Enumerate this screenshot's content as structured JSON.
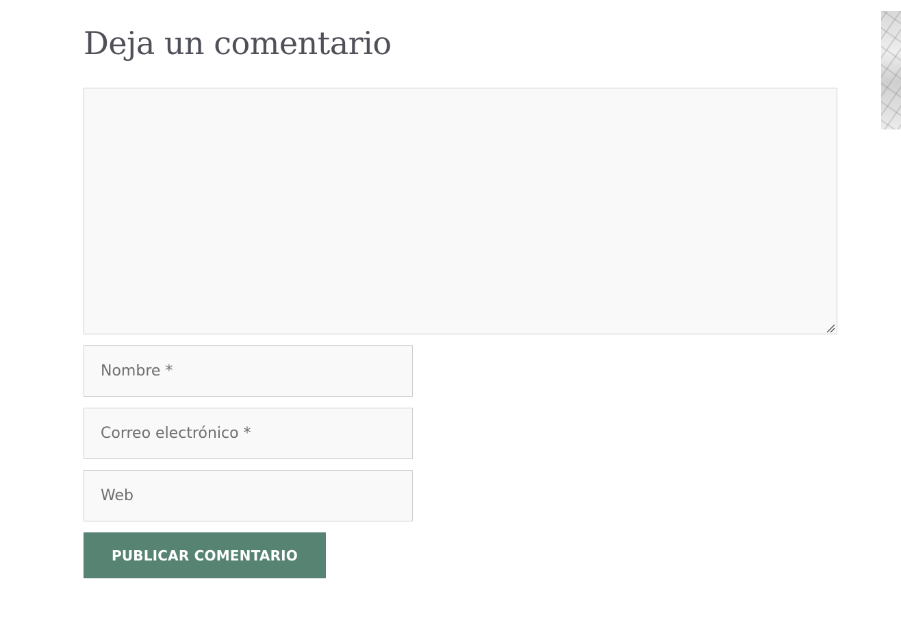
{
  "comment_form": {
    "title": "Deja un comentario",
    "comment_value": "",
    "name_placeholder": "Nombre *",
    "email_placeholder": "Correo electrónico *",
    "website_placeholder": "Web",
    "submit_label": "PUBLICAR COMENTARIO"
  },
  "icons": {
    "resize_grip": "resize-grip-icon"
  },
  "colors": {
    "heading_text": "#505059",
    "field_background": "#f9f9f9",
    "field_border": "#cfcfcf",
    "placeholder_text": "#6f6f6f",
    "button_background": "#568372",
    "button_text": "#ffffff"
  }
}
